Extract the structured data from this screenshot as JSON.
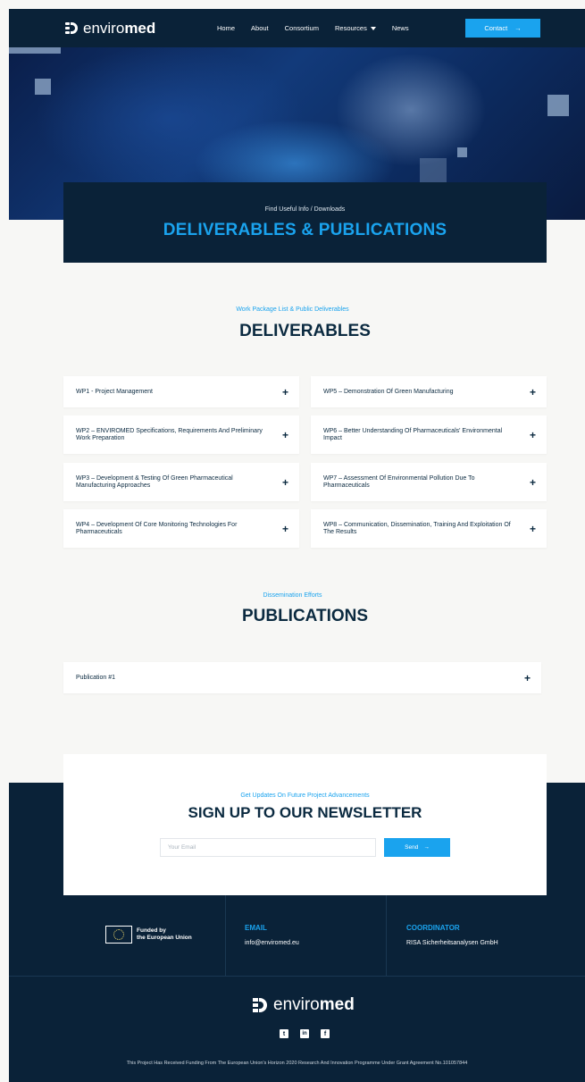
{
  "nav": {
    "logo_light": "enviro",
    "logo_bold": "med",
    "items": [
      {
        "label": "Home"
      },
      {
        "label": "About"
      },
      {
        "label": "Consortium"
      },
      {
        "label": "Resources"
      },
      {
        "label": "News"
      }
    ],
    "contact_label": "Contact",
    "contact_arrow": "→"
  },
  "hero": {
    "subtitle": "Find Useful Info / Downloads",
    "title": "DELIVERABLES & PUBLICATIONS"
  },
  "deliverables": {
    "kicker": "Work Package List & Public Deliverables",
    "title": "DELIVERABLES",
    "items": [
      {
        "label": "WP1 - Project Management"
      },
      {
        "label": "WP5 – Demonstration Of Green Manufacturing"
      },
      {
        "label": "WP2 – ENVIROMED Specifications, Requirements And Preliminary Work Preparation"
      },
      {
        "label": "WP6 – Better Understanding Of Pharmaceuticals' Environmental Impact"
      },
      {
        "label": "WP3 – Development & Testing Of Green Pharmaceutical Manufacturing Approaches"
      },
      {
        "label": "WP7 – Assessment Of Environmental Pollution Due To Pharmaceuticals"
      },
      {
        "label": "WP4 – Development Of Core Monitoring Technologies For Pharmaceuticals"
      },
      {
        "label": "WP8 – Communication, Dissemination, Training And Exploitation Of The Results"
      }
    ],
    "expand_symbol": "+"
  },
  "publications": {
    "kicker": "Dissemination Efforts",
    "title": "PUBLICATIONS",
    "items": [
      {
        "label": "Publication #1"
      }
    ]
  },
  "newsletter": {
    "kicker": "Get Updates On Future Project Advancements",
    "title": "SIGN UP TO OUR NEWSLETTER",
    "email_placeholder": "Your Email",
    "email_value": "",
    "send_label": "Send",
    "send_arrow": "→"
  },
  "footer": {
    "eu_line1": "Funded by",
    "eu_line2": "the European Union",
    "email_label": "EMAIL",
    "email_value": "info@enviromed.eu",
    "coordinator_label": "COORDINATOR",
    "coordinator_value": "RISA Sicherheitsanalysen GmbH",
    "logo_light": "enviro",
    "logo_bold": "med",
    "social": [
      {
        "icon": "twitter-icon",
        "glyph": "t"
      },
      {
        "icon": "linkedin-icon",
        "glyph": "in"
      },
      {
        "icon": "facebook-icon",
        "glyph": "f"
      }
    ],
    "grant_text": "This Project Has Received Funding From The European Union's Horizon 2020 Research And Innovation Programme Under Grant Agreement No.101057844"
  },
  "colors": {
    "navy": "#0a2238",
    "accent": "#1aa3ee",
    "background": "#f7f7f5"
  }
}
